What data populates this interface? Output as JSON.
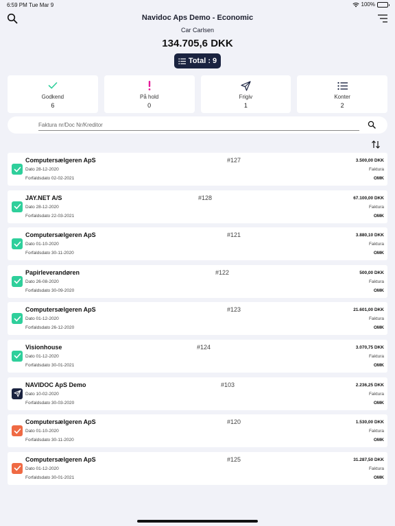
{
  "status_bar": {
    "time": "6:59 PM",
    "date": "Tue Mar 9",
    "battery": "100%"
  },
  "header": {
    "title": "Navidoc Aps Demo - Economic",
    "company": "Car Carlsen",
    "amount": "134.705,6 DKK",
    "total_label": "Total : 9"
  },
  "tiles": [
    {
      "label": "Godkend",
      "count": "6",
      "icon": "check-icon",
      "color": "#2fcf9b"
    },
    {
      "label": "På hold",
      "count": "0",
      "icon": "exclamation-icon",
      "color": "#e6199a"
    },
    {
      "label": "Frigiv",
      "count": "1",
      "icon": "paper-plane-icon",
      "color": "#1a2340"
    },
    {
      "label": "Konter",
      "count": "2",
      "icon": "list-icon",
      "color": "#1a2340"
    }
  ],
  "search": {
    "placeholder": "Faktura nr/Doc Nr/Kreditor",
    "value": ""
  },
  "invoices": [
    {
      "name": "Computersælgeren ApS",
      "number": "#127",
      "date": "Dato 28-12-2020",
      "due": "Forfaldsdato 02-02-2021",
      "amount": "3.500,00 DKK",
      "type": "Faktura",
      "status": "OMK",
      "state": "approved"
    },
    {
      "name": "JAY.NET A/S",
      "number": "#128",
      "date": "Dato 28-12-2020",
      "due": "Forfaldsdato 22-03-2021",
      "amount": "67.100,00 DKK",
      "type": "Faktura",
      "status": "OMK",
      "state": "approved"
    },
    {
      "name": "Computersælgeren ApS",
      "number": "#121",
      "date": "Dato 01-10-2020",
      "due": "Forfaldsdato 30-11-2020",
      "amount": "3.880,10 DKK",
      "type": "Faktura",
      "status": "OMK",
      "state": "approved"
    },
    {
      "name": "Papirleverandøren",
      "number": "#122",
      "date": "Dato 26-08-2020",
      "due": "Forfaldsdato 30-09-2020",
      "amount": "500,00 DKK",
      "type": "Faktura",
      "status": "OMK",
      "state": "approved"
    },
    {
      "name": "Computersælgeren ApS",
      "number": "#123",
      "date": "Dato 01-12-2020",
      "due": "Forfaldsdato 26-12-2020",
      "amount": "21.601,00 DKK",
      "type": "Faktura",
      "status": "OMK",
      "state": "approved"
    },
    {
      "name": "Visionhouse",
      "number": "#124",
      "date": "Dato 01-12-2020",
      "due": "Forfaldsdato 30-01-2021",
      "amount": "3.070,75 DKK",
      "type": "Faktura",
      "status": "OMK",
      "state": "approved"
    },
    {
      "name": "NAVIDOC ApS Demo",
      "number": "#103",
      "date": "Dato 10-02-2020",
      "due": "Forfaldsdato 30-03-2020",
      "amount": "2.236,25 DKK",
      "type": "Faktura",
      "status": "OMK",
      "state": "release"
    },
    {
      "name": "Computersælgeren ApS",
      "number": "#120",
      "date": "Dato 01-10-2020",
      "due": "Forfaldsdato 30-11-2020",
      "amount": "1.530,00 DKK",
      "type": "Faktura",
      "status": "OMK",
      "state": "posting"
    },
    {
      "name": "Computersælgeren ApS",
      "number": "#125",
      "date": "Dato 01-12-2020",
      "due": "Forfaldsdato 30-01-2021",
      "amount": "31.287,50 DKK",
      "type": "Faktura",
      "status": "OMK",
      "state": "posting"
    }
  ]
}
